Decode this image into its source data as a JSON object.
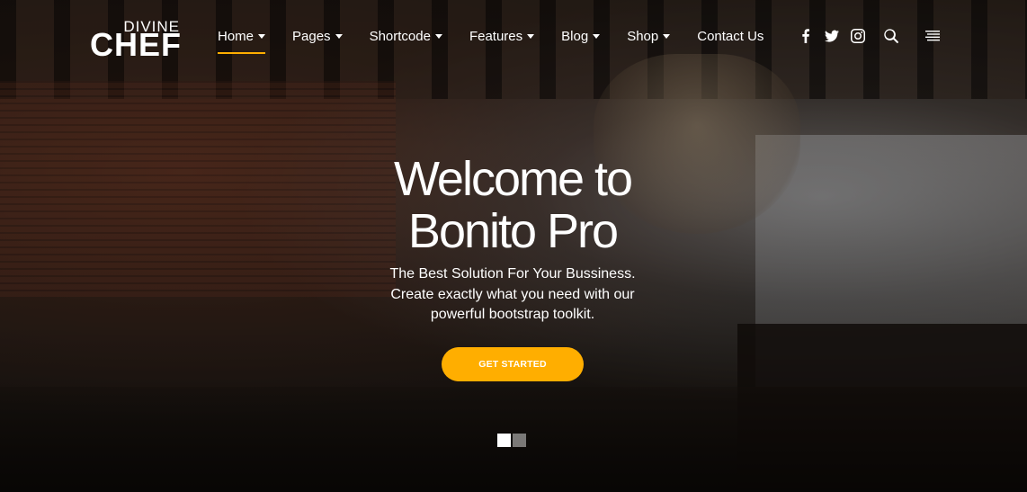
{
  "brand": {
    "logo_top": "DIVINE",
    "logo_main": "CHEF"
  },
  "nav": {
    "items": [
      {
        "label": "Home",
        "has_caret": true,
        "active": true
      },
      {
        "label": "Pages",
        "has_caret": true
      },
      {
        "label": "Shortcode",
        "has_caret": true
      },
      {
        "label": "Features",
        "has_caret": true
      },
      {
        "label": "Blog",
        "has_caret": true
      },
      {
        "label": "Shop",
        "has_caret": true
      },
      {
        "label": "Contact Us",
        "has_caret": false
      }
    ]
  },
  "header_icons": [
    "facebook-icon",
    "twitter-icon",
    "instagram-icon",
    "search-icon",
    "menu-icon"
  ],
  "hero": {
    "title_line1": "Welcome to",
    "title_line2": "Bonito Pro",
    "subtitle_line1": "The Best Solution For Your Bussiness.",
    "subtitle_line2": "Create exactly what you need with our",
    "subtitle_line3": "powerful bootstrap toolkit.",
    "cta_label": "GET STARTED"
  },
  "slider": {
    "slide_count": 2,
    "active_slide": 1
  },
  "colors": {
    "accent": "#ffae00",
    "text": "#ffffff"
  }
}
